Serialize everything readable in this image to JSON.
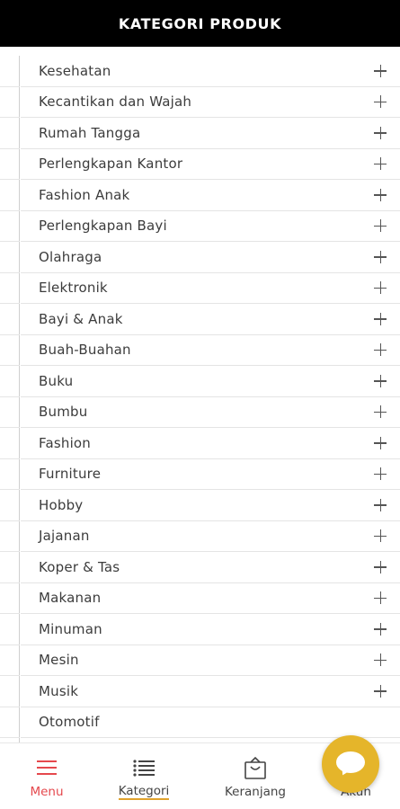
{
  "header": {
    "title": "KATEGORI PRODUK"
  },
  "categories": [
    {
      "label": "Kesehatan",
      "expandable": true
    },
    {
      "label": "Kecantikan dan Wajah",
      "expandable": true
    },
    {
      "label": "Rumah Tangga",
      "expandable": true
    },
    {
      "label": "Perlengkapan Kantor",
      "expandable": true
    },
    {
      "label": "Fashion Anak",
      "expandable": true
    },
    {
      "label": "Perlengkapan Bayi",
      "expandable": true
    },
    {
      "label": "Olahraga",
      "expandable": true
    },
    {
      "label": "Elektronik",
      "expandable": true
    },
    {
      "label": "Bayi & Anak",
      "expandable": true
    },
    {
      "label": "Buah-Buahan",
      "expandable": true
    },
    {
      "label": "Buku",
      "expandable": true
    },
    {
      "label": "Bumbu",
      "expandable": true
    },
    {
      "label": "Fashion",
      "expandable": true
    },
    {
      "label": "Furniture",
      "expandable": true
    },
    {
      "label": "Hobby",
      "expandable": true
    },
    {
      "label": "Jajanan",
      "expandable": true
    },
    {
      "label": "Koper & Tas",
      "expandable": true
    },
    {
      "label": "Makanan",
      "expandable": true
    },
    {
      "label": "Minuman",
      "expandable": true
    },
    {
      "label": "Mesin",
      "expandable": true
    },
    {
      "label": "Musik",
      "expandable": true
    },
    {
      "label": "Otomotif",
      "expandable": false
    }
  ],
  "bottom_nav": {
    "menu": {
      "label": "Menu",
      "icon": "hamburger-icon",
      "active": true
    },
    "kategori": {
      "label": "Kategori",
      "icon": "list-icon"
    },
    "keranjang": {
      "label": "Keranjang",
      "icon": "shopping-bag-icon"
    },
    "akun": {
      "label": "Akun",
      "icon": "user-icon"
    }
  },
  "chat": {
    "icon": "chat-bubble-icon"
  },
  "colors": {
    "header_bg": "#000000",
    "active_nav": "#e5484d",
    "accent": "#e5b52a",
    "underline": "#e0a22c"
  }
}
